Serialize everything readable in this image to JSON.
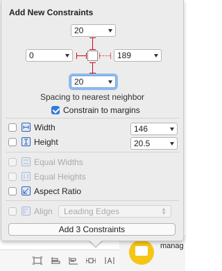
{
  "popover": {
    "title": "Add New Constraints",
    "spacing": {
      "top": "20",
      "left": "0",
      "right": "189",
      "bottom": "20",
      "caption": "Spacing to nearest neighbor"
    },
    "constrain_to_margins": {
      "label": "Constrain to margins",
      "checked": true
    },
    "width": {
      "label": "Width",
      "value": "146",
      "checked": false
    },
    "height": {
      "label": "Height",
      "value": "20.5",
      "checked": false
    },
    "equal_widths": {
      "label": "Equal Widths",
      "enabled": false
    },
    "equal_heights": {
      "label": "Equal Heights",
      "enabled": false
    },
    "aspect_ratio": {
      "label": "Aspect Ratio",
      "checked": false
    },
    "align": {
      "label": "Align",
      "value": "Leading Edges",
      "enabled": false
    },
    "add_button": "Add 3 Constraints"
  },
  "editor": {
    "object_label": "manag",
    "accent_color": "#2f7de1",
    "constraint_color": "#d0021b",
    "object_icon_color": "#f5c518"
  },
  "bottom_toolbar": {
    "icons": [
      "embed-in-stack-icon",
      "update-frames-icon",
      "align-icon",
      "add-constraints-icon",
      "resolve-issues-icon"
    ]
  }
}
